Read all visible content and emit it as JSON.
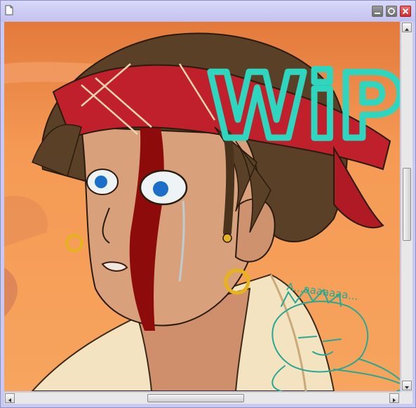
{
  "window": {
    "title": "",
    "buttons": [
      "minimize",
      "maximize",
      "close"
    ]
  },
  "artwork": {
    "overlay_text": "WiP",
    "sketch_caption": "A...aaaaaaa...",
    "colors": {
      "sky_top": "#e9813f",
      "sky_bottom": "#f6a25b",
      "bandana": "#c0202b",
      "hair": "#5a4026",
      "skin": "#d59b77",
      "blood": "#8e0b0b",
      "eye": "#1b6fc8",
      "earring": "#e6b31c",
      "wip_text": "#2fd6bf",
      "sketch": "#27a893",
      "shirt": "#f3e3c1"
    }
  },
  "scrollbars": {
    "vertical_position": 0.48,
    "horizontal_position": 0.43
  }
}
